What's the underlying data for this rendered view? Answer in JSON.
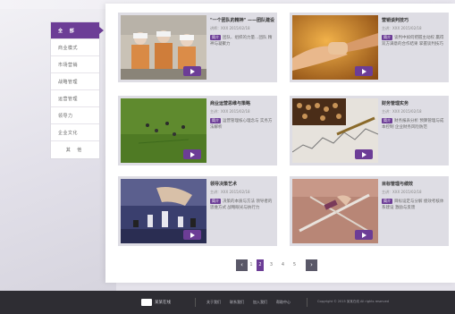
{
  "sidebar": {
    "items": [
      {
        "label": "全 部",
        "active": true
      },
      {
        "label": "商业模式"
      },
      {
        "label": "市场营销"
      },
      {
        "label": "战略管理"
      },
      {
        "label": "运营管理"
      },
      {
        "label": "领导力"
      },
      {
        "label": "企业文化"
      },
      {
        "label": "其 他"
      }
    ]
  },
  "cards": [
    {
      "title": "\"一个团队的精神\" ——团队建设",
      "meta": "讲师：XXX  2015/02/18",
      "tag": "简介",
      "desc": "团队、组织的力量…团队 精神与凝聚力",
      "thumb": "thumb-workers"
    },
    {
      "title": "营销谈判技巧",
      "meta": "主讲：XXX  2015/02/18",
      "tag": "简介",
      "desc": "谈判中如何把握主动权 赢得双方满意的合作结果 掌握谈判技巧",
      "thumb": "thumb-handshake"
    },
    {
      "title": "商业运营思维与策略",
      "meta": "主讲：XXX  2015/02/18",
      "tag": "简介",
      "desc": "运营管理核心理念与 实务方法解析",
      "thumb": "thumb-golf"
    },
    {
      "title": "财务管理实务",
      "meta": "主讲：XXX  2015/02/18",
      "tag": "简介",
      "desc": "财务报表分析 预算管理与成本控制 企业财务风险防范",
      "thumb": "thumb-abacus"
    },
    {
      "title": "领导决策艺术",
      "meta": "主讲：XXX  2015/02/18",
      "tag": "简介",
      "desc": "决策的本质与方法 领导者的思维方式 战略眼光与执行力",
      "thumb": "thumb-chess"
    },
    {
      "title": "目标管理与绩效",
      "meta": "主讲：XXX  2015/02/18",
      "tag": "简介",
      "desc": "目标设定与分解 绩效考核体系建设 激励与反馈",
      "thumb": "thumb-target"
    }
  ],
  "pager": {
    "prev": "‹",
    "next": "›",
    "pages": [
      "1",
      "2",
      "3",
      "4",
      "5"
    ],
    "current": "1"
  },
  "footer": {
    "logo_text": "某某在线",
    "links": [
      "关于我们",
      "联系我们",
      "加入我们",
      "帮助中心"
    ],
    "copyright": "Copyright © 2015 某某在线 All rights reserved"
  },
  "colors": {
    "accent": "#6c3d96",
    "footer_bg": "#2e2d33",
    "card_bg": "#dedde4"
  }
}
